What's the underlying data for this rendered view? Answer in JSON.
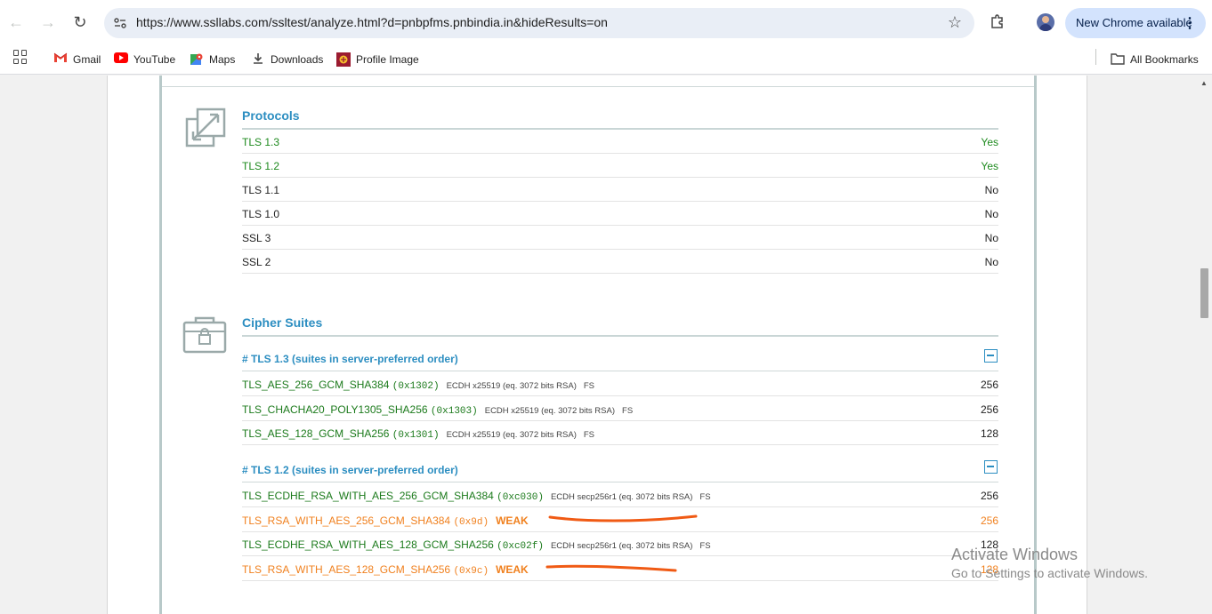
{
  "browser": {
    "url": "https://www.ssllabs.com/ssltest/analyze.html?d=pnbpfms.pnbindia.in&hideResults=on",
    "update_label": "New Chrome available"
  },
  "bookmarks": [
    {
      "label": "Gmail",
      "icon": "gmail-icon"
    },
    {
      "label": "YouTube",
      "icon": "youtube-icon"
    },
    {
      "label": "Maps",
      "icon": "maps-icon"
    },
    {
      "label": "Downloads",
      "icon": "download-icon"
    },
    {
      "label": "Profile Image",
      "icon": "profile-image-icon"
    }
  ],
  "all_bookmarks_label": "All Bookmarks",
  "protocols": {
    "title": "Protocols",
    "rows": [
      {
        "name": "TLS 1.3",
        "value": "Yes",
        "status": "ok"
      },
      {
        "name": "TLS 1.2",
        "value": "Yes",
        "status": "ok"
      },
      {
        "name": "TLS 1.1",
        "value": "No",
        "status": "neutral"
      },
      {
        "name": "TLS 1.0",
        "value": "No",
        "status": "neutral"
      },
      {
        "name": "SSL 3",
        "value": "No",
        "status": "neutral"
      },
      {
        "name": "SSL 2",
        "value": "No",
        "status": "neutral"
      }
    ]
  },
  "cipher_suites": {
    "title": "Cipher Suites",
    "groups": [
      {
        "heading": "# TLS 1.3 (suites in server-preferred order)",
        "suites": [
          {
            "name": "TLS_AES_256_GCM_SHA384",
            "code": "(0x1302)",
            "kex": "ECDH x25519 (eq. 3072 bits RSA)",
            "fs": "FS",
            "bits": "256",
            "weak": ""
          },
          {
            "name": "TLS_CHACHA20_POLY1305_SHA256",
            "code": "(0x1303)",
            "kex": "ECDH x25519 (eq. 3072 bits RSA)",
            "fs": "FS",
            "bits": "256",
            "weak": ""
          },
          {
            "name": "TLS_AES_128_GCM_SHA256",
            "code": "(0x1301)",
            "kex": "ECDH x25519 (eq. 3072 bits RSA)",
            "fs": "FS",
            "bits": "128",
            "weak": ""
          }
        ]
      },
      {
        "heading": "# TLS 1.2 (suites in server-preferred order)",
        "suites": [
          {
            "name": "TLS_ECDHE_RSA_WITH_AES_256_GCM_SHA384",
            "code": "(0xc030)",
            "kex": "ECDH secp256r1 (eq. 3072 bits RSA)",
            "fs": "FS",
            "bits": "256",
            "weak": ""
          },
          {
            "name": "TLS_RSA_WITH_AES_256_GCM_SHA384",
            "code": "(0x9d)",
            "kex": "",
            "fs": "",
            "bits": "256",
            "weak": "WEAK"
          },
          {
            "name": "TLS_ECDHE_RSA_WITH_AES_128_GCM_SHA256",
            "code": "(0xc02f)",
            "kex": "ECDH secp256r1 (eq. 3072 bits RSA)",
            "fs": "FS",
            "bits": "128",
            "weak": ""
          },
          {
            "name": "TLS_RSA_WITH_AES_128_GCM_SHA256",
            "code": "(0x9c)",
            "kex": "",
            "fs": "",
            "bits": "128",
            "weak": "WEAK"
          }
        ]
      }
    ]
  },
  "watermark": {
    "line1": "Activate Windows",
    "line2": "Go to Settings to activate Windows."
  },
  "colors": {
    "ok_green": "#1e8a1e",
    "weak_orange": "#f0801e",
    "heading_blue": "#2c8ec1",
    "annotation_red": "#f05a14"
  }
}
